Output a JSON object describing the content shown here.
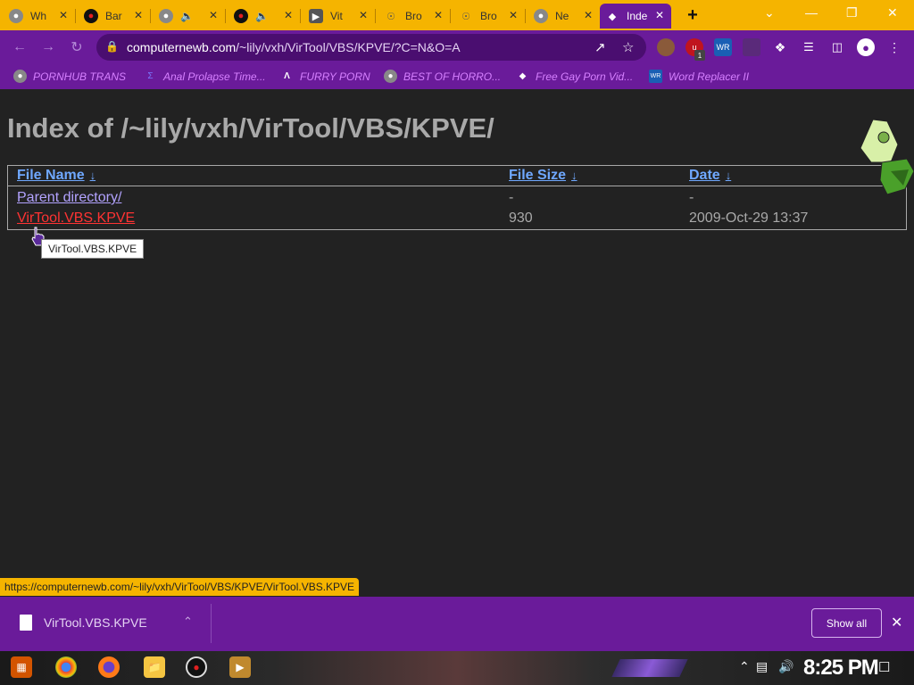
{
  "tabs": [
    {
      "title": "Wh",
      "icon": "chrome-icon",
      "active": false
    },
    {
      "title": "Bar",
      "icon": "record-icon",
      "active": false
    },
    {
      "title": "🔈",
      "icon": "chrome-icon",
      "active": false
    },
    {
      "title": "🔈",
      "icon": "record-icon",
      "active": false
    },
    {
      "title": "Vit",
      "icon": "play-icon",
      "active": false
    },
    {
      "title": "Bro",
      "icon": "ufo-icon",
      "active": false
    },
    {
      "title": "Bro",
      "icon": "ufo-icon",
      "active": false
    },
    {
      "title": "Ne",
      "icon": "chrome-icon",
      "active": false
    },
    {
      "title": "Inde",
      "icon": "gem-icon",
      "active": true
    }
  ],
  "newtab_label": "+",
  "window_controls": {
    "dropdown": "⌄",
    "minimize": "—",
    "restore": "❐",
    "close": "✕"
  },
  "omnibox": {
    "domain": "computernewb.com",
    "path": "/~lily/vxh/VirTool/VBS/KPVE/?C=N&O=A"
  },
  "extension_badge": "1",
  "bookmarks": [
    {
      "label": "PORNHUB TRANS",
      "icon": "chrome-icon"
    },
    {
      "label": "Anal Prolapse Time...",
      "icon": "sigma-icon"
    },
    {
      "label": "FURRY PORN",
      "icon": "lambda-icon"
    },
    {
      "label": "BEST OF HORRO...",
      "icon": "chrome-icon"
    },
    {
      "label": "Free Gay Porn Vid...",
      "icon": "gem-icon"
    },
    {
      "label": "Word Replacer II",
      "icon": "wr-icon"
    }
  ],
  "page": {
    "heading": "Index of /~lily/vxh/VirTool/VBS/KPVE/",
    "columns": {
      "name": "File Name",
      "size": "File Size",
      "date": "Date",
      "sort_arrow": "↓"
    },
    "rows": [
      {
        "name": "Parent directory/",
        "size": "-",
        "date": "-"
      },
      {
        "name": "VirTool.VBS.KPVE",
        "size": "930",
        "date": "2009-Oct-29 13:37"
      }
    ],
    "tooltip": "VirTool.VBS.KPVE"
  },
  "status_url": "https://computernewb.com/~lily/vxh/VirTool/VBS/KPVE/VirTool.VBS.KPVE",
  "download_shelf": {
    "file_name": "VirTool.VBS.KPVE",
    "show_all": "Show all"
  },
  "taskbar": {
    "clock": "8:25 PM"
  },
  "colors": {
    "tab_strip": "#f5b400",
    "toolbar": "#6a1b9a",
    "page_bg": "#222222",
    "link": "#b3a3ff",
    "link_hover": "#ff3333",
    "header_link": "#6fa8ff"
  }
}
